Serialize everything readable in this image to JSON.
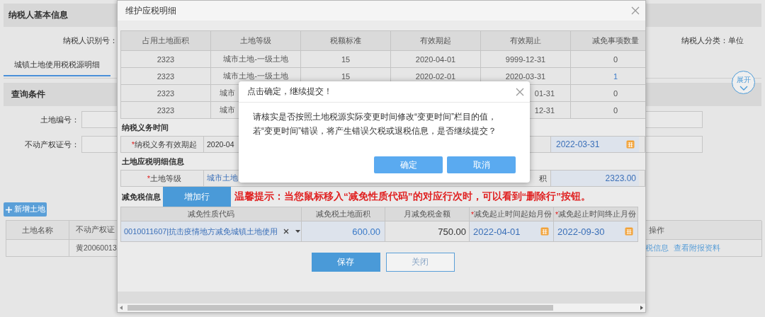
{
  "page": {
    "header": {
      "title": "纳税人基本信息"
    },
    "taxpayer_id_label": "纳税人识别号：",
    "taxpayer_type": "纳税人分类：单位",
    "tabs": [
      {
        "label": "城镇土地使用税税源明细",
        "selected": true
      }
    ],
    "query": {
      "title": "查询条件",
      "expand_button": "展开",
      "fields": [
        {
          "label": "土地编号："
        },
        {
          "label": "不动产权证号："
        }
      ]
    },
    "add_button": "新增土地",
    "table": {
      "columns": [
        "土地名称",
        "不动产权证",
        "操作"
      ],
      "rows": [
        {
          "cells": [
            null,
            "黄20060013"
          ],
          "links": [
            "税信息",
            "查看附报资料"
          ]
        }
      ]
    }
  },
  "modal": {
    "title": "维护应税明细",
    "table": {
      "columns": [
        "占用土地面积",
        "土地等级",
        "税额标准",
        "有效期起",
        "有效期止",
        "减免事项数量"
      ],
      "rows": [
        {
          "cells": [
            "2323",
            "城市土地-一级土地",
            "15",
            "2020-04-01",
            "9999-12-31",
            "0"
          ]
        },
        {
          "cells": [
            "2323",
            "城市土地-一级土地",
            "15",
            "2020-02-01",
            "2020-03-31",
            {
              "text": "1",
              "link": true
            }
          ]
        },
        {
          "cells": [
            "2323",
            {
              "text": "城市",
              "clipped_end": true
            },
            null,
            null,
            {
              "text": "01-31",
              "clipped_start": true
            },
            "0"
          ]
        },
        {
          "cells": [
            "2323",
            {
              "text": "城市",
              "clipped_end": true
            },
            null,
            null,
            {
              "text": "12-31",
              "clipped_start": true
            },
            "0"
          ]
        }
      ]
    },
    "obligation": {
      "title": "纳税义务时间",
      "required_mark": "*",
      "label": "纳税义务有效期起",
      "start_value": "2020-04",
      "end_value": "2022-03-31"
    },
    "detail": {
      "title": "土地应税明细信息",
      "required_mark": "*",
      "grade_label": "土地等级",
      "grade_value": "城市土地",
      "area_label": "积",
      "area_value": "2323.00"
    },
    "relief": {
      "title": "减免税信息",
      "add_row_button": "增加行",
      "tip": "温馨提示：当您鼠标移入“减免性质代码”的对应行次时，可以看到“删除行”按钮。",
      "columns": [
        {
          "label": "减免性质代码"
        },
        {
          "label": "减免税土地面积"
        },
        {
          "label": "月减免税金额"
        },
        {
          "label": "减免起止时间起始月份",
          "required_mark": "*"
        },
        {
          "label": "减免起止时间终止月份",
          "required_mark": "*"
        }
      ],
      "rows": [
        {
          "code": "0010011607|抗击疫情地方减免城镇土地使用",
          "area": "600.00",
          "amount": "750.00",
          "start_month": "2022-04-01",
          "end_month": "2022-09-30"
        }
      ]
    },
    "buttons": [
      {
        "label": "保存",
        "kind": "primary"
      },
      {
        "label": "关闭",
        "kind": "secondary"
      }
    ]
  },
  "confirm": {
    "title": "点击确定，继续提交！",
    "message": "请核实是否按照土地税源实际变更时间修改“变更时间”栏目的值，若“变更时间”错误，将产生错误欠税或退税信息，是否继续提交？",
    "buttons": [
      {
        "label": "确定"
      },
      {
        "label": "取消"
      }
    ]
  }
}
